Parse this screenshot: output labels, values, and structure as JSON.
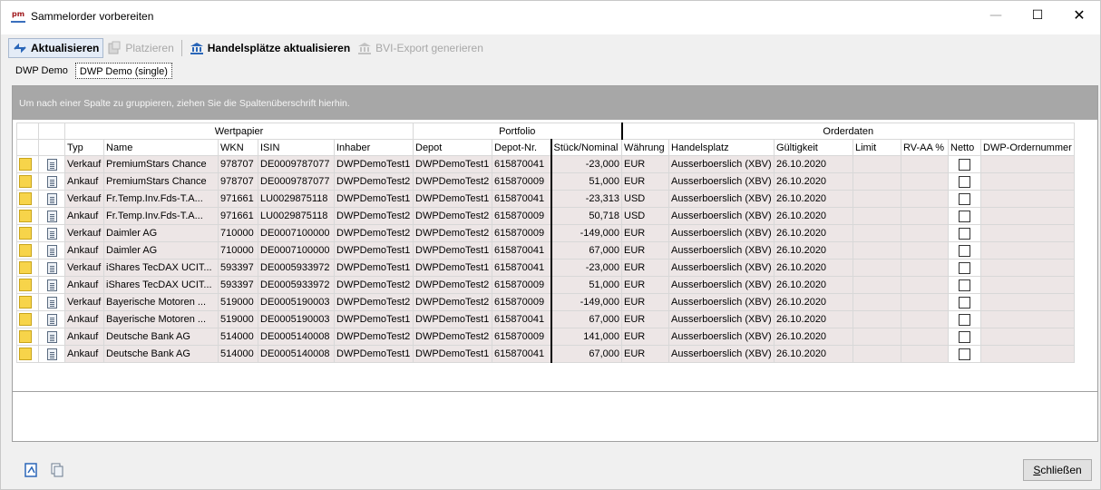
{
  "window": {
    "app_icon_text": "pm",
    "title": "Sammelorder vorbereiten",
    "minimize_glyph": "—",
    "maximize_glyph": "☐",
    "close_glyph": "✕"
  },
  "toolbar": {
    "refresh_label": "Aktualisieren",
    "place_label": "Platzieren",
    "update_venues_label": "Handelsplätze aktualisieren",
    "bvi_export_label": "BVI-Export generieren"
  },
  "tabs": [
    {
      "label": "DWP Demo",
      "active": false
    },
    {
      "label": "DWP Demo (single)",
      "active": true
    }
  ],
  "grid": {
    "group_hint": "Um nach einer Spalte zu gruppieren, ziehen Sie die Spaltenüberschrift hierhin.",
    "band_headers": {
      "wertpapier": "Wertpapier",
      "portfolio": "Portfolio",
      "orderdaten": "Orderdaten"
    },
    "columns": {
      "typ": "Typ",
      "name": "Name",
      "wkn": "WKN",
      "isin": "ISIN",
      "inhaber": "Inhaber",
      "depot": "Depot",
      "depot_nr": "Depot-Nr.",
      "stueck": "Stück/Nominal",
      "waehrung": "Währung",
      "handelsplatz": "Handelsplatz",
      "gueltigkeit": "Gültigkeit",
      "limit": "Limit",
      "rv_aa": "RV-AA %",
      "netto": "Netto",
      "ordernummer": "DWP-Ordernummer"
    },
    "rows": [
      {
        "typ": "Verkauf",
        "name": "PremiumStars Chance",
        "wkn": "978707",
        "isin": "DE0009787077",
        "inhaber": "DWPDemoTest1",
        "depot": "DWPDemoTest1",
        "depot_nr": "615870041",
        "stueck": "-23,000",
        "waehrung": "EUR",
        "handelsplatz": "Ausserboerslich (XBV)",
        "gueltigkeit": "26.10.2020",
        "limit": "",
        "rv_aa": "",
        "ordernummer": ""
      },
      {
        "typ": "Ankauf",
        "name": "PremiumStars Chance",
        "wkn": "978707",
        "isin": "DE0009787077",
        "inhaber": "DWPDemoTest2",
        "depot": "DWPDemoTest2",
        "depot_nr": "615870009",
        "stueck": "51,000",
        "waehrung": "EUR",
        "handelsplatz": "Ausserboerslich (XBV)",
        "gueltigkeit": "26.10.2020",
        "limit": "",
        "rv_aa": "",
        "ordernummer": ""
      },
      {
        "typ": "Verkauf",
        "name": "Fr.Temp.Inv.Fds-T.A...",
        "wkn": "971661",
        "isin": "LU0029875118",
        "inhaber": "DWPDemoTest1",
        "depot": "DWPDemoTest1",
        "depot_nr": "615870041",
        "stueck": "-23,313",
        "waehrung": "USD",
        "handelsplatz": "Ausserboerslich (XBV)",
        "gueltigkeit": "26.10.2020",
        "limit": "",
        "rv_aa": "",
        "ordernummer": ""
      },
      {
        "typ": "Ankauf",
        "name": "Fr.Temp.Inv.Fds-T.A...",
        "wkn": "971661",
        "isin": "LU0029875118",
        "inhaber": "DWPDemoTest2",
        "depot": "DWPDemoTest2",
        "depot_nr": "615870009",
        "stueck": "50,718",
        "waehrung": "USD",
        "handelsplatz": "Ausserboerslich (XBV)",
        "gueltigkeit": "26.10.2020",
        "limit": "",
        "rv_aa": "",
        "ordernummer": ""
      },
      {
        "typ": "Verkauf",
        "name": "Daimler AG",
        "wkn": "710000",
        "isin": "DE0007100000",
        "inhaber": "DWPDemoTest2",
        "depot": "DWPDemoTest2",
        "depot_nr": "615870009",
        "stueck": "-149,000",
        "waehrung": "EUR",
        "handelsplatz": "Ausserboerslich (XBV)",
        "gueltigkeit": "26.10.2020",
        "limit": "",
        "rv_aa": "",
        "ordernummer": ""
      },
      {
        "typ": "Ankauf",
        "name": "Daimler AG",
        "wkn": "710000",
        "isin": "DE0007100000",
        "inhaber": "DWPDemoTest1",
        "depot": "DWPDemoTest1",
        "depot_nr": "615870041",
        "stueck": "67,000",
        "waehrung": "EUR",
        "handelsplatz": "Ausserboerslich (XBV)",
        "gueltigkeit": "26.10.2020",
        "limit": "",
        "rv_aa": "",
        "ordernummer": ""
      },
      {
        "typ": "Verkauf",
        "name": "iShares TecDAX UCIT...",
        "wkn": "593397",
        "isin": "DE0005933972",
        "inhaber": "DWPDemoTest1",
        "depot": "DWPDemoTest1",
        "depot_nr": "615870041",
        "stueck": "-23,000",
        "waehrung": "EUR",
        "handelsplatz": "Ausserboerslich (XBV)",
        "gueltigkeit": "26.10.2020",
        "limit": "",
        "rv_aa": "",
        "ordernummer": ""
      },
      {
        "typ": "Ankauf",
        "name": "iShares TecDAX UCIT...",
        "wkn": "593397",
        "isin": "DE0005933972",
        "inhaber": "DWPDemoTest2",
        "depot": "DWPDemoTest2",
        "depot_nr": "615870009",
        "stueck": "51,000",
        "waehrung": "EUR",
        "handelsplatz": "Ausserboerslich (XBV)",
        "gueltigkeit": "26.10.2020",
        "limit": "",
        "rv_aa": "",
        "ordernummer": ""
      },
      {
        "typ": "Verkauf",
        "name": "Bayerische Motoren ...",
        "wkn": "519000",
        "isin": "DE0005190003",
        "inhaber": "DWPDemoTest2",
        "depot": "DWPDemoTest2",
        "depot_nr": "615870009",
        "stueck": "-149,000",
        "waehrung": "EUR",
        "handelsplatz": "Ausserboerslich (XBV)",
        "gueltigkeit": "26.10.2020",
        "limit": "",
        "rv_aa": "",
        "ordernummer": ""
      },
      {
        "typ": "Ankauf",
        "name": "Bayerische Motoren ...",
        "wkn": "519000",
        "isin": "DE0005190003",
        "inhaber": "DWPDemoTest1",
        "depot": "DWPDemoTest1",
        "depot_nr": "615870041",
        "stueck": "67,000",
        "waehrung": "EUR",
        "handelsplatz": "Ausserboerslich (XBV)",
        "gueltigkeit": "26.10.2020",
        "limit": "",
        "rv_aa": "",
        "ordernummer": ""
      },
      {
        "typ": "Ankauf",
        "name": "Deutsche Bank AG",
        "wkn": "514000",
        "isin": "DE0005140008",
        "inhaber": "DWPDemoTest2",
        "depot": "DWPDemoTest2",
        "depot_nr": "615870009",
        "stueck": "141,000",
        "waehrung": "EUR",
        "handelsplatz": "Ausserboerslich (XBV)",
        "gueltigkeit": "26.10.2020",
        "limit": "",
        "rv_aa": "",
        "ordernummer": ""
      },
      {
        "typ": "Ankauf",
        "name": "Deutsche Bank AG",
        "wkn": "514000",
        "isin": "DE0005140008",
        "inhaber": "DWPDemoTest1",
        "depot": "DWPDemoTest1",
        "depot_nr": "615870041",
        "stueck": "67,000",
        "waehrung": "EUR",
        "handelsplatz": "Ausserboerslich (XBV)",
        "gueltigkeit": "26.10.2020",
        "limit": "",
        "rv_aa": "",
        "ordernummer": ""
      }
    ]
  },
  "footer": {
    "close_button_label_underlined": "S",
    "close_button_label_rest": "chließen",
    "icons": [
      "export-pdf-icon",
      "print-icon"
    ]
  },
  "colors": {
    "row_background": "#ede6e6",
    "group_bar": "#a7a7a7",
    "selector_yellow": "#f7d44a"
  }
}
